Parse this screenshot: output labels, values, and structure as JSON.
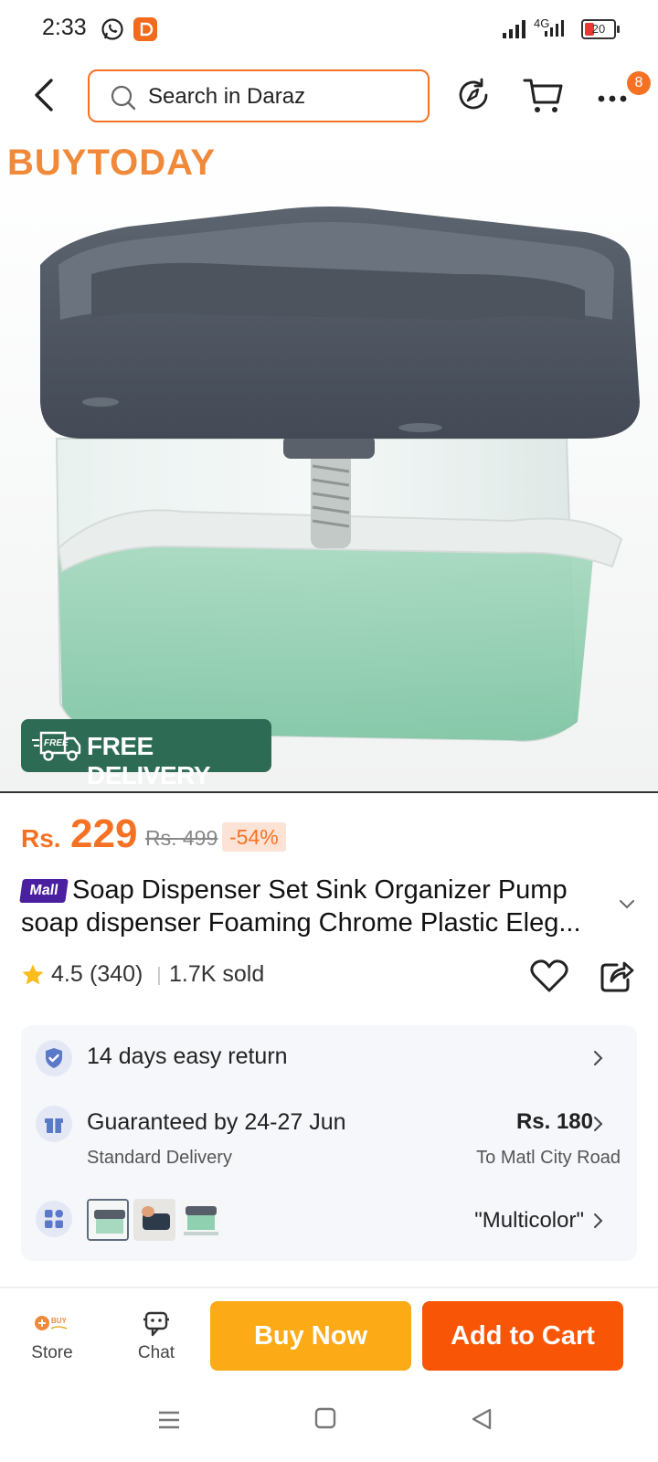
{
  "status_bar": {
    "time": "2:33",
    "network": "4G",
    "battery": "20"
  },
  "top_bar": {
    "search_placeholder": "Search in Daraz",
    "notification_count": "8"
  },
  "hero": {
    "brand": "BUYTODAY",
    "delivery_badge": "FREE DELIVERY",
    "delivery_icon_label": "FREE"
  },
  "price": {
    "currency": "Rs.",
    "current": "229",
    "original": "Rs. 499",
    "discount": "-54%"
  },
  "product": {
    "mall_badge": "Mall",
    "title": "Soap Dispenser Set Sink Organizer Pump soap dispenser Foaming Chrome Plastic Eleg..."
  },
  "rating": {
    "value": "4.5",
    "count": "(340)",
    "sold": "1.7K sold"
  },
  "info": {
    "return_policy": "14 days easy return",
    "delivery_guarantee": "Guaranteed by 24-27 Jun",
    "delivery_type": "Standard Delivery",
    "shipping_fee": "Rs. 180",
    "shipping_location": "To Matl City Road",
    "variant_selected": "\"Multicolor\""
  },
  "actions": {
    "store_label": "Store",
    "store_logo_text": "BUY",
    "chat_label": "Chat",
    "buy_now": "Buy Now",
    "add_to_cart": "Add to Cart"
  },
  "colors": {
    "accent": "#f57224",
    "buy_now": "#fcab17",
    "add_to_cart": "#f85606",
    "delivery_badge": "#2e6b55",
    "mall_badge": "#4a1fa0"
  },
  "icons": [
    "back-arrow-icon",
    "search-icon",
    "refresh-icon",
    "cart-icon",
    "more-icon",
    "star-icon",
    "heart-icon",
    "share-icon",
    "shield-check-icon",
    "gift-icon",
    "variants-icon",
    "chevron-right-icon",
    "chat-icon",
    "truck-icon"
  ]
}
